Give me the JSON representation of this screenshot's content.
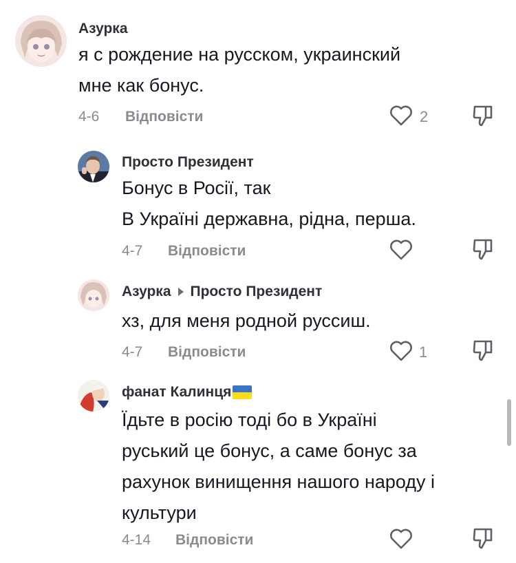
{
  "comments": [
    {
      "author": "Азурка",
      "text": "я с рождение на русском, украинский\nмне как бонус.",
      "date": "4-6",
      "reply_label": "Відповісти",
      "likes": "2"
    },
    {
      "author": "Просто Президент",
      "text": "Бонус в Росії, так\nВ Україні державна, рідна, перша.",
      "date": "4-7",
      "reply_label": "Відповісти",
      "likes": ""
    },
    {
      "author": "Азурка",
      "reply_to": "Просто Президент",
      "text": "хз, для меня родной руссиш.",
      "date": "4-7",
      "reply_label": "Відповісти",
      "likes": "1"
    },
    {
      "author": "фанат Калинця",
      "text": "Їдьте в росію тоді бо в Україні\nруський це бонус, а саме бонус за\nрахунок винищення нашого народу і\nкультури",
      "date": "4-14",
      "reply_label": "Відповісти",
      "likes": ""
    }
  ],
  "icons": {
    "like": "heart-outline-icon",
    "dislike": "thumbs-down-icon",
    "reply_arrow": "triangle-right-icon",
    "flag": "ukraine-flag-icon"
  },
  "colors": {
    "flag_blue": "#3a75c4",
    "flag_yellow": "#f9dd16",
    "muted": "#8a8b91"
  }
}
